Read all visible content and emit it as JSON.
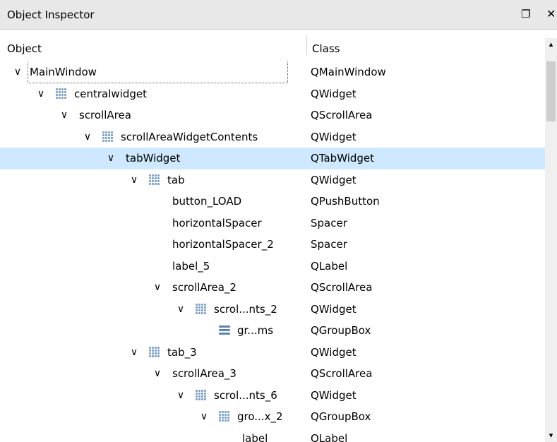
{
  "panel": {
    "title": "Object Inspector",
    "float_icon": "float-window-icon",
    "close_icon": "close-icon"
  },
  "columns": {
    "object": "Object",
    "class": "Class"
  },
  "tree": [
    {
      "name": "MainWindow",
      "class": "QMainWindow",
      "depth": 0,
      "expanded": true,
      "icon": "none",
      "state": "current"
    },
    {
      "name": "centralwidget",
      "class": "QWidget",
      "depth": 1,
      "expanded": true,
      "icon": "grid-layout-icon"
    },
    {
      "name": "scrollArea",
      "class": "QScrollArea",
      "depth": 2,
      "expanded": true,
      "icon": "none"
    },
    {
      "name": "scrollAreaWidgetContents",
      "class": "QWidget",
      "depth": 3,
      "expanded": true,
      "icon": "grid-layout-icon"
    },
    {
      "name": "tabWidget",
      "class": "QTabWidget",
      "depth": 4,
      "expanded": true,
      "icon": "none",
      "state": "selected"
    },
    {
      "name": "tab",
      "class": "QWidget",
      "depth": 5,
      "expanded": true,
      "icon": "grid-layout-icon"
    },
    {
      "name": "button_LOAD",
      "class": "QPushButton",
      "depth": 6,
      "icon": "none"
    },
    {
      "name": "horizontalSpacer",
      "class": "Spacer",
      "depth": 6,
      "icon": "none"
    },
    {
      "name": "horizontalSpacer_2",
      "class": "Spacer",
      "depth": 6,
      "icon": "none"
    },
    {
      "name": "label_5",
      "class": "QLabel",
      "depth": 6,
      "icon": "none"
    },
    {
      "name": "scrollArea_2",
      "class": "QScrollArea",
      "depth": 6,
      "expanded": true,
      "icon": "none"
    },
    {
      "name": "scrol...nts_2",
      "class": "QWidget",
      "depth": 7,
      "expanded": true,
      "icon": "grid-layout-icon"
    },
    {
      "name": "gr...ms",
      "class": "QGroupBox",
      "depth": 8,
      "icon": "group-box-icon"
    },
    {
      "name": "tab_3",
      "class": "QWidget",
      "depth": 5,
      "expanded": true,
      "icon": "grid-layout-icon"
    },
    {
      "name": "scrollArea_3",
      "class": "QScrollArea",
      "depth": 6,
      "expanded": true,
      "icon": "none"
    },
    {
      "name": "scrol...nts_6",
      "class": "QWidget",
      "depth": 7,
      "expanded": true,
      "icon": "grid-layout-icon"
    },
    {
      "name": "gro...x_2",
      "class": "QGroupBox",
      "depth": 8,
      "expanded": true,
      "icon": "grid-layout-icon"
    },
    {
      "name": "label",
      "class": "QLabel",
      "depth": 9,
      "icon": "none"
    }
  ],
  "colors": {
    "selection": "#cde8ff",
    "title_bar": "#e8e8e8",
    "layout_icon": "#7ea0c4"
  }
}
